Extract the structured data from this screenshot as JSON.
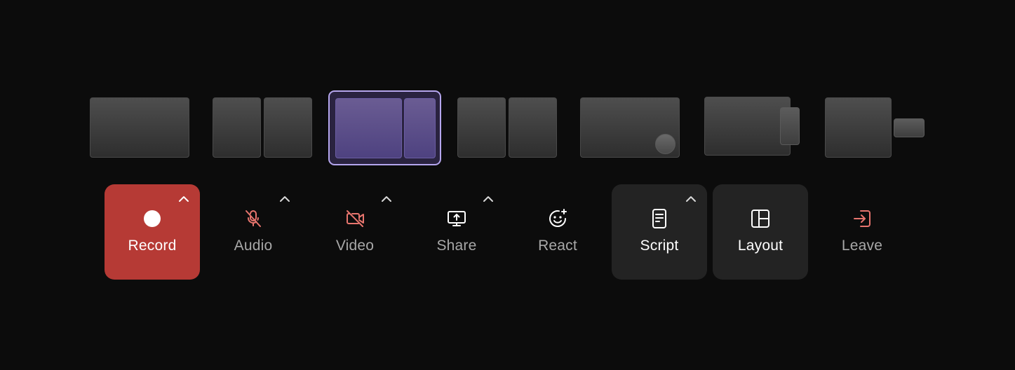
{
  "colors": {
    "background": "#0c0c0c",
    "record_bg": "#b63a35",
    "muted_red": "#e8756e",
    "selected_layout_border": "#b5a6ee",
    "selected_layout_fill": "#5d4f8a",
    "active_button_bg": "#232323"
  },
  "layout_picker": {
    "selected_index": 2,
    "options": [
      {
        "icon": "single-tile-layout-icon"
      },
      {
        "icon": "two-equal-tiles-layout-icon"
      },
      {
        "icon": "large-small-tiles-layout-icon"
      },
      {
        "icon": "two-equal-tiles-layout-icon"
      },
      {
        "icon": "tile-with-circle-overlay-layout-icon"
      },
      {
        "icon": "tile-with-side-panel-layout-icon"
      },
      {
        "icon": "tile-with-mini-tile-layout-icon"
      }
    ]
  },
  "controls": {
    "record": {
      "label": "Record",
      "icon": "record-dot-icon",
      "has_menu": true
    },
    "audio": {
      "label": "Audio",
      "icon": "microphone-off-icon",
      "has_menu": true,
      "state": "muted"
    },
    "video": {
      "label": "Video",
      "icon": "camera-off-icon",
      "has_menu": true,
      "state": "off"
    },
    "share": {
      "label": "Share",
      "icon": "screen-share-icon",
      "has_menu": true
    },
    "react": {
      "label": "React",
      "icon": "emoji-plus-icon",
      "has_menu": false
    },
    "script": {
      "label": "Script",
      "icon": "document-icon",
      "has_menu": true
    },
    "layout": {
      "label": "Layout",
      "icon": "layout-grid-icon",
      "has_menu": false
    },
    "leave": {
      "label": "Leave",
      "icon": "exit-icon",
      "has_menu": false
    }
  }
}
